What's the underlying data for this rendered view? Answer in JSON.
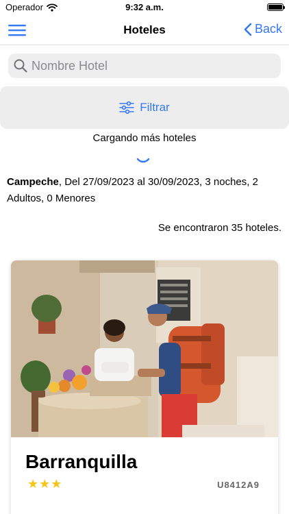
{
  "status_bar": {
    "carrier": "Operador",
    "time": "9:32 a.m."
  },
  "nav": {
    "title": "Hoteles",
    "back_label": "Back"
  },
  "search": {
    "placeholder": "Nombre Hotel",
    "value": ""
  },
  "filter": {
    "label": "Filtrar"
  },
  "loading": {
    "text": "Cargando más hoteles"
  },
  "summary": {
    "city": "Campeche",
    "details": ", Del 27/09/2023 al 30/09/2023, 3 noches, 2 Adultos, 0 Menores"
  },
  "results": {
    "text": "Se encontraron 35 hoteles."
  },
  "hotels": [
    {
      "name": "Barranquilla",
      "stars": "★★★",
      "code": "U8412A9"
    }
  ],
  "colors": {
    "accent": "#3478f6",
    "star": "#f5c518",
    "search_bg": "#eeeeef",
    "filter_bg": "#ededee"
  }
}
